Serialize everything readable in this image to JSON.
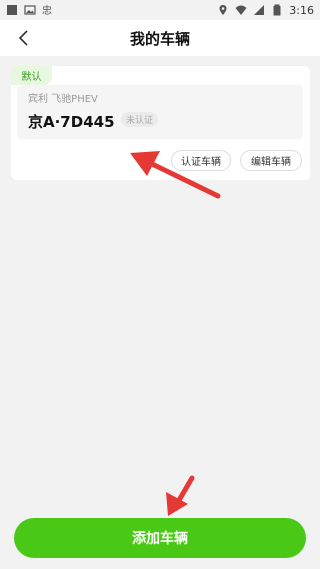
{
  "status_bar": {
    "time": "3:16"
  },
  "header": {
    "title": "我的车辆"
  },
  "vehicle": {
    "default_label": "默认",
    "model": "宾利 飞驰PHEV",
    "plate": "京A·7D445",
    "status": "未认证",
    "verify_label": "认证车辆",
    "edit_label": "编辑车辆"
  },
  "footer": {
    "add_label": "添加车辆"
  },
  "colors": {
    "accent": "#49c916",
    "badge_text": "#3aa01f",
    "annotation_arrow": "#e53935"
  }
}
